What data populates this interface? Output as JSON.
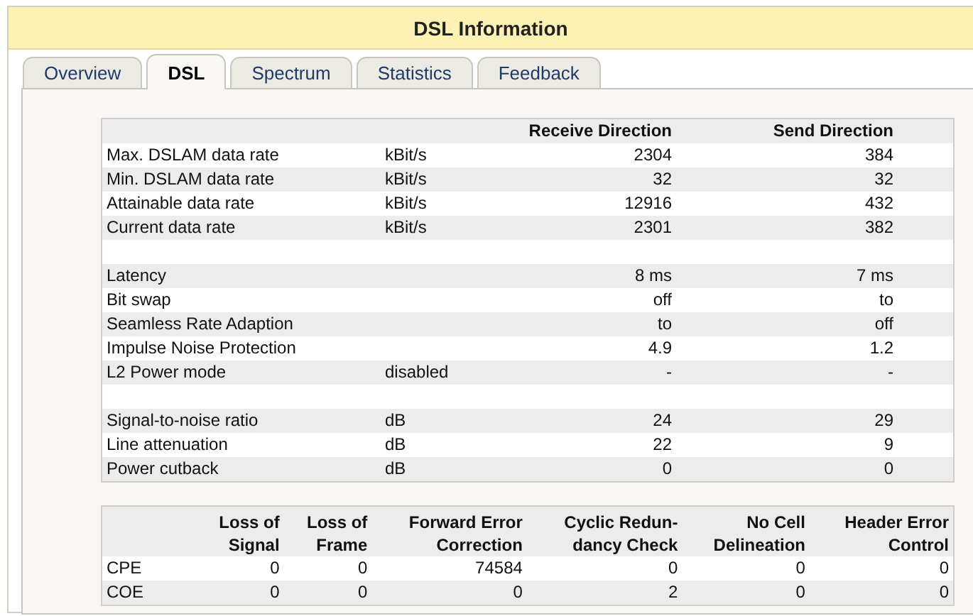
{
  "window": {
    "title": "DSL Information"
  },
  "tabs": [
    {
      "label": "Overview",
      "selected": false
    },
    {
      "label": "DSL",
      "selected": true
    },
    {
      "label": "Spectrum",
      "selected": false
    },
    {
      "label": "Statistics",
      "selected": false
    },
    {
      "label": "Feedback",
      "selected": false
    }
  ],
  "line_table": {
    "columns": [
      "Receive Direction",
      "Send Direction"
    ],
    "groups": [
      {
        "rows": [
          {
            "label": "Max. DSLAM data rate",
            "unit": "kBit/s",
            "receive": "2304",
            "send": "384"
          },
          {
            "label": "Min. DSLAM data rate",
            "unit": "kBit/s",
            "receive": "32",
            "send": "32"
          },
          {
            "label": "Attainable data rate",
            "unit": "kBit/s",
            "receive": "12916",
            "send": "432"
          },
          {
            "label": "Current data rate",
            "unit": "kBit/s",
            "receive": "2301",
            "send": "382"
          }
        ]
      },
      {
        "rows": [
          {
            "label": "Latency",
            "receive": "8 ms",
            "send": "7 ms"
          },
          {
            "label": "Bit swap",
            "receive": "off",
            "send": "to"
          },
          {
            "label": "Seamless Rate Adaption",
            "receive": "to",
            "send": "off"
          },
          {
            "label": "Impulse Noise Protection",
            "receive": "4.9",
            "send": "1.2"
          },
          {
            "label": "L2 Power mode",
            "unit": "disabled",
            "receive": "-",
            "send": "-"
          }
        ]
      },
      {
        "rows": [
          {
            "label": "Signal-to-noise ratio",
            "unit": "dB",
            "receive": "24",
            "send": "29"
          },
          {
            "label": "Line attenuation",
            "unit": "dB",
            "receive": "22",
            "send": "9"
          },
          {
            "label": "Power cutback",
            "unit": "dB",
            "receive": "0",
            "send": "0"
          }
        ]
      }
    ]
  },
  "error_table": {
    "columns": [
      [
        "Loss of",
        "Signal"
      ],
      [
        "Loss of",
        "Frame"
      ],
      [
        "Forward Error",
        "Correction"
      ],
      [
        "Cyclic Redun-",
        "dancy Check"
      ],
      [
        "No Cell",
        "Delineation"
      ],
      [
        "Header Error",
        "Control"
      ]
    ],
    "rows": [
      {
        "label": "CPE",
        "values": [
          "0",
          "0",
          "74584",
          "0",
          "0",
          "0"
        ]
      },
      {
        "label": "COE",
        "values": [
          "0",
          "0",
          "0",
          "2",
          "0",
          "0"
        ]
      }
    ]
  }
}
